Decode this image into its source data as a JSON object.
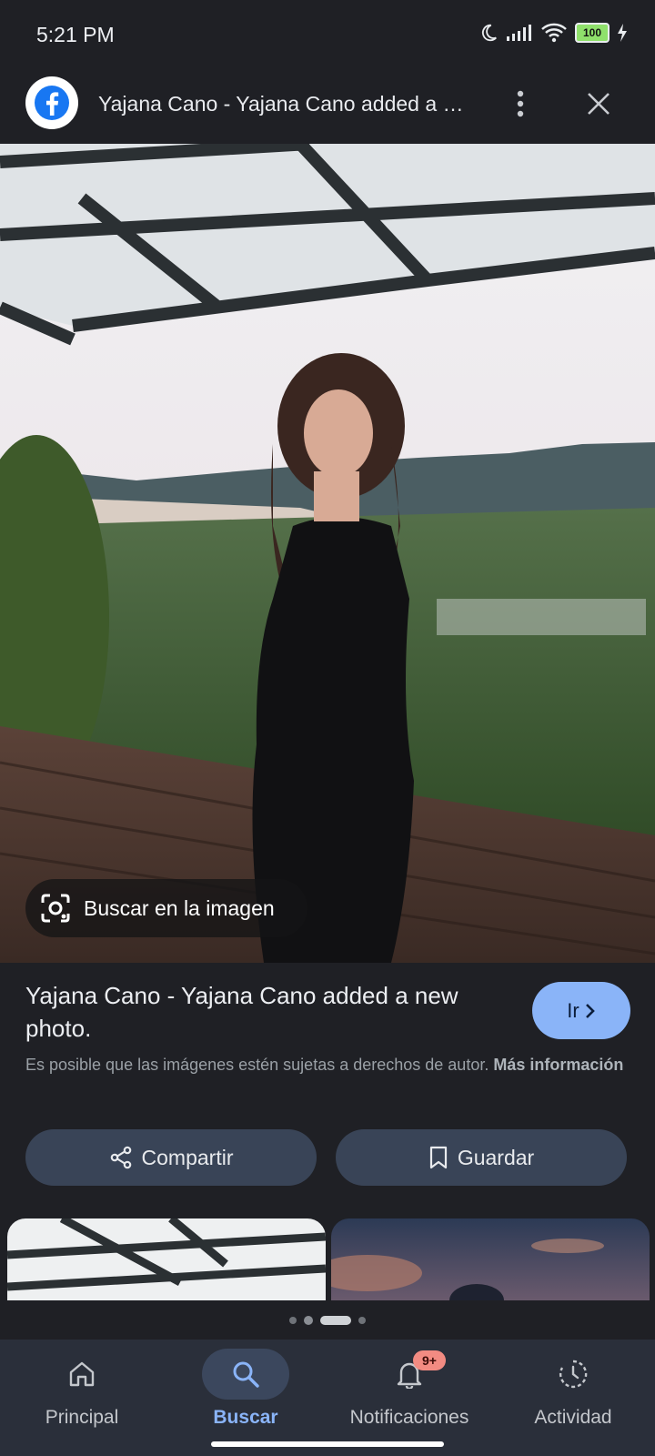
{
  "status_bar": {
    "time": "5:21 PM",
    "battery": "100"
  },
  "top_bar": {
    "title": "Yajana Cano - Yajana Cano added a new photo."
  },
  "hero": {
    "lens_label": "Buscar en la imagen"
  },
  "info": {
    "title": "Yajana Cano - Yajana Cano added a new photo.",
    "go_label": "Ir",
    "copyright_text": "Es posible que las imágenes estén sujetas a derechos de autor.",
    "more_info_label": "Más información"
  },
  "actions": {
    "share_label": "Compartir",
    "save_label": "Guardar"
  },
  "bottom_nav": {
    "items": [
      {
        "label": "Principal",
        "icon": "home-icon"
      },
      {
        "label": "Buscar",
        "icon": "search-icon",
        "active": true
      },
      {
        "label": "Notificaciones",
        "icon": "bell-icon",
        "badge": "9+"
      },
      {
        "label": "Actividad",
        "icon": "activity-icon"
      }
    ]
  },
  "colors": {
    "accent": "#8ab4f8",
    "background": "#1f2025",
    "nav_background": "#2a2f3a",
    "badge": "#f28b82"
  }
}
